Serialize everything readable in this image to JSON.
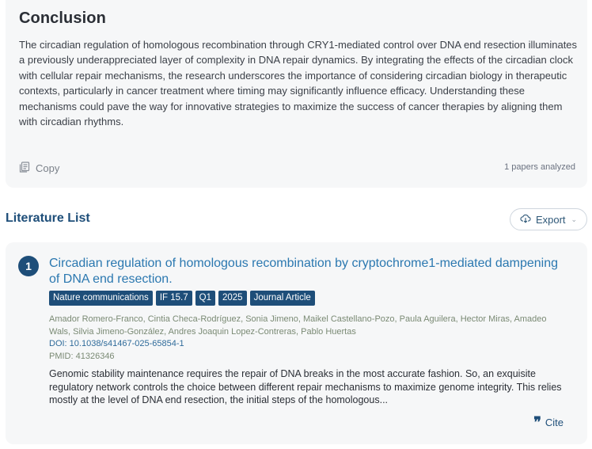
{
  "conclusion": {
    "title": "Conclusion",
    "body": "The circadian regulation of homologous recombination through CRY1-mediated control over DNA end resection illuminates a previously underappreciated layer of complexity in DNA repair dynamics. By integrating the effects of the circadian clock with cellular repair mechanisms, the research underscores the importance of considering circadian biology in therapeutic contexts, particularly in cancer treatment where timing may significantly influence efficacy. Understanding these mechanisms could pave the way for innovative strategies to maximize the success of cancer therapies by aligning them with circadian rhythms.",
    "copy_label": "Copy",
    "papers_analyzed": "1 papers analyzed"
  },
  "literature": {
    "header": "Literature List",
    "export_label": "Export",
    "papers": [
      {
        "index": "1",
        "title": "Circadian regulation of homologous recombination by cryptochrome1-mediated dampening of DNA end resection.",
        "tags": [
          "Nature communications",
          "IF 15.7",
          "Q1",
          "2025",
          "Journal Article"
        ],
        "authors": "Amador Romero-Franco, Cintia Checa-Rodríguez, Sonia Jimeno, Maikel Castellano-Pozo, Paula Aguilera, Hector Miras, Amadeo Wals, Silvia Jimeno-González, Andres Joaquin Lopez-Contreras, Pablo Huertas",
        "doi": "DOI: 10.1038/s41467-025-65854-1",
        "pmid": "PMID: 41326346",
        "abstract": "Genomic stability maintenance requires the repair of DNA breaks in the most accurate fashion. So, an exquisite regulatory network controls the choice between different repair mechanisms to maximize genome integrity. This relies mostly at the level of DNA end resection, the initial steps of the homologous...",
        "cite_label": "Cite"
      }
    ]
  },
  "colors": {
    "accent": "#1e4e79",
    "link": "#2b78b0",
    "card_bg": "#f6f7f8"
  },
  "icons": {
    "copy": "copy-icon",
    "export": "cloud-download-icon",
    "cite": "quote-icon"
  }
}
